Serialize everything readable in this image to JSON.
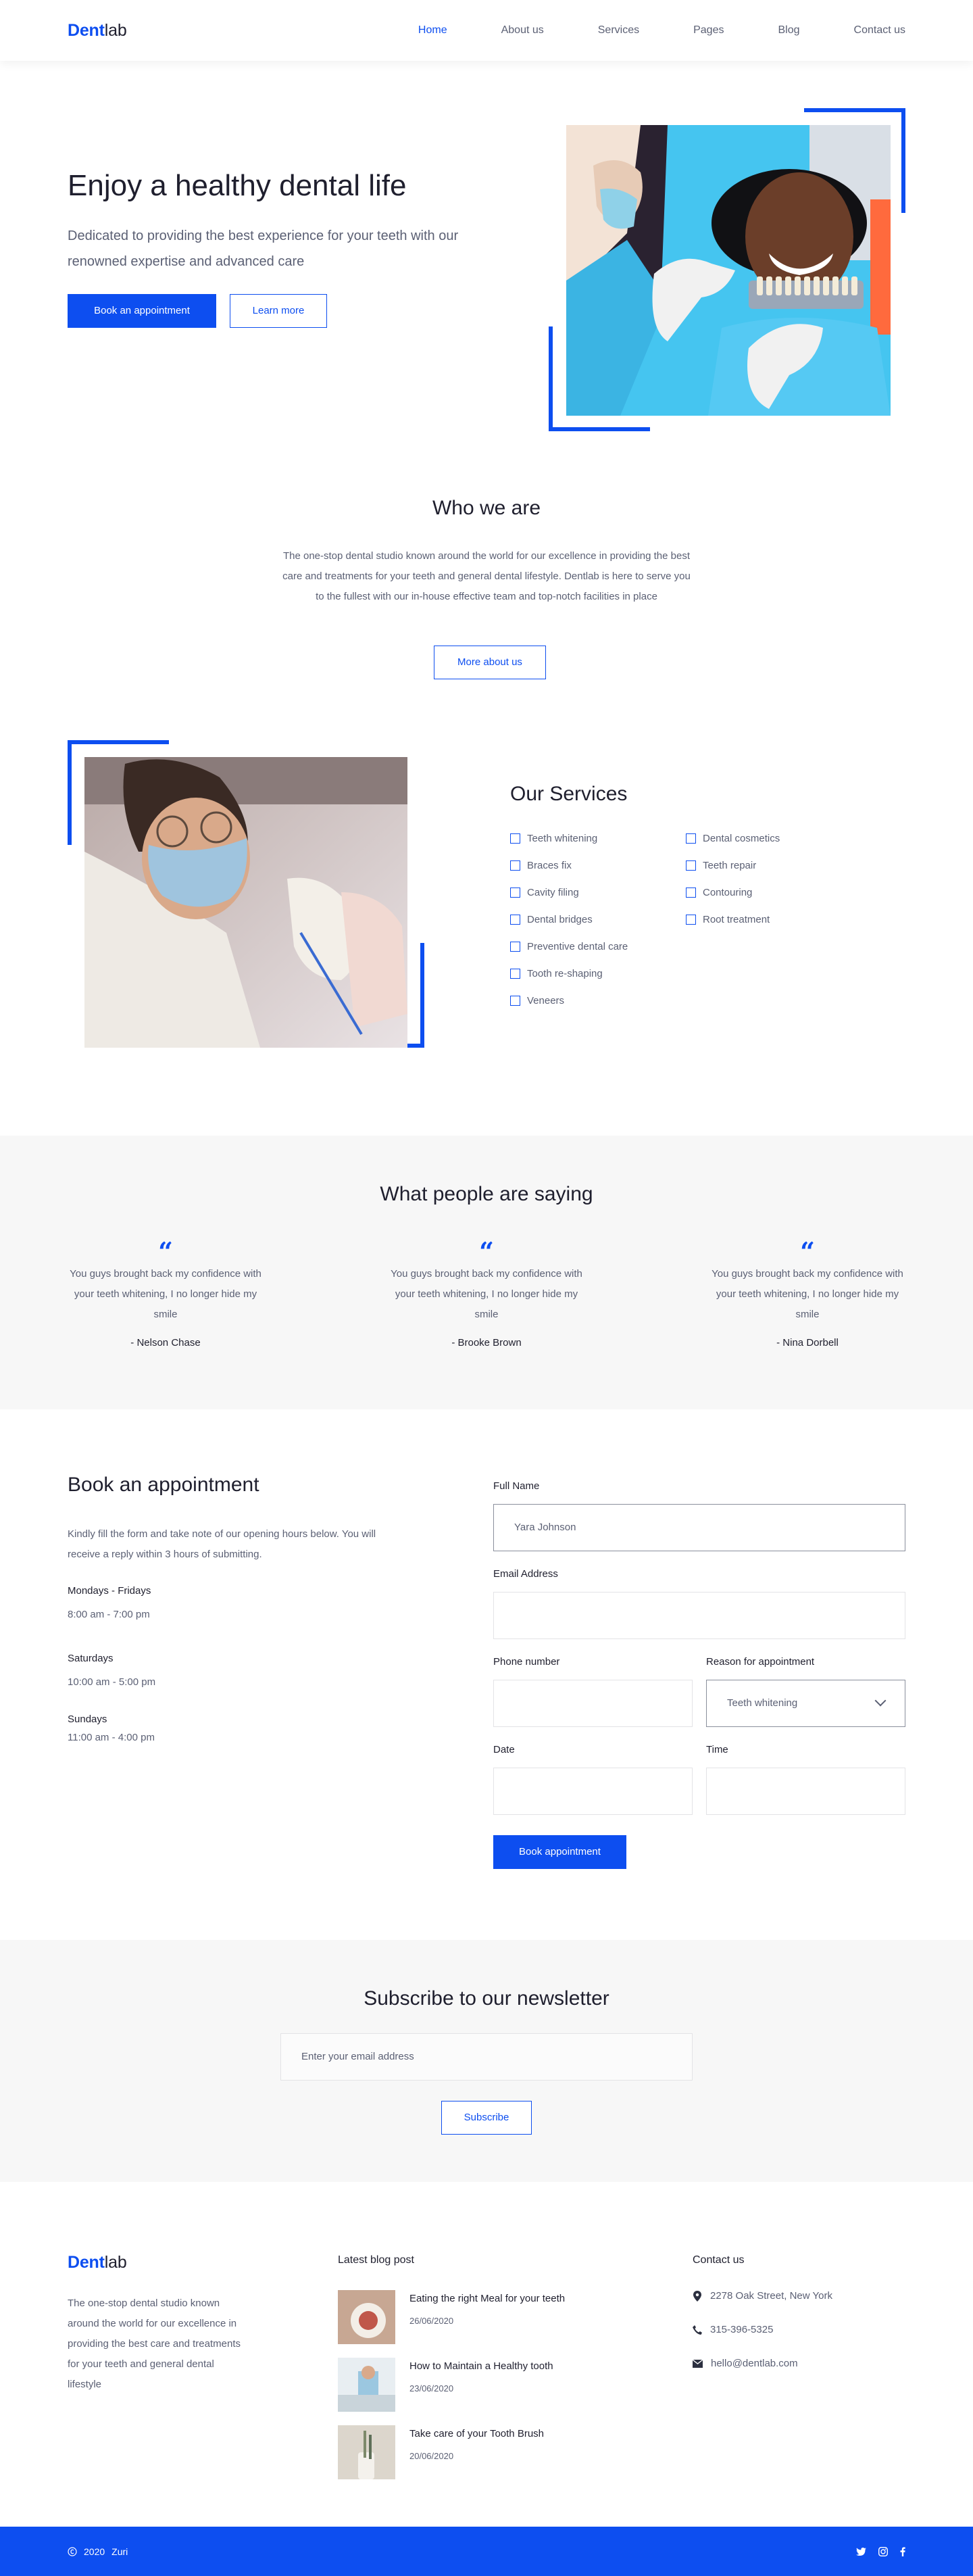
{
  "brand": {
    "part1": "Dent",
    "part2": "lab"
  },
  "nav": {
    "items": [
      {
        "label": "Home",
        "active": true
      },
      {
        "label": "About us",
        "active": false
      },
      {
        "label": "Services",
        "active": false
      },
      {
        "label": "Pages",
        "active": false
      },
      {
        "label": "Blog",
        "active": false
      },
      {
        "label": "Contact us",
        "active": false
      }
    ]
  },
  "hero": {
    "title": "Enjoy a healthy dental life",
    "subtitle": "Dedicated to providing the best experience for your teeth with our renowned expertise and advanced care",
    "primary_cta": "Book an appointment",
    "secondary_cta": "Learn more"
  },
  "about": {
    "title": "Who we are",
    "text": "The one-stop dental studio known around the world for our excellence in providing the best care and treatments for your teeth and general dental lifestyle. Dentlab is here to serve you to the fullest with our in-house effective team and top-notch facilities in place",
    "cta": "More about us"
  },
  "services": {
    "title": "Our Services",
    "col1": [
      "Teeth whitening",
      "Braces fix",
      "Cavity filing",
      "Dental bridges",
      "Preventive dental care",
      "Tooth re-shaping",
      "Veneers"
    ],
    "col2": [
      "Dental cosmetics",
      "Teeth repair",
      "Contouring",
      "Root treatment"
    ]
  },
  "testimonials": {
    "title": "What people are saying",
    "quote_mark": "“",
    "items": [
      {
        "text": "You guys brought back my confidence with your teeth whitening, I no longer hide my smile",
        "name": "- Nelson Chase"
      },
      {
        "text": "You guys brought back my confidence with your teeth whitening, I no longer hide my smile",
        "name": "- Brooke Brown"
      },
      {
        "text": "You guys brought back my confidence with your teeth whitening, I no longer hide my smile",
        "name": "- Nina Dorbell"
      }
    ]
  },
  "appointment": {
    "title": "Book an appointment",
    "desc": "Kindly fill the form and take note of our opening hours below. You will receive a reply within 3 hours of submitting.",
    "hours": [
      {
        "day": "Mondays - Fridays",
        "time": "8:00 am - 7:00 pm"
      },
      {
        "day": "Saturdays",
        "time": "10:00 am - 5:00 pm"
      },
      {
        "day": "Sundays",
        "time": "11:00 am - 4:00 pm"
      }
    ],
    "form": {
      "full_name_label": "Full Name",
      "full_name_value": "Yara Johnson",
      "email_label": "Email Address",
      "phone_label": "Phone number",
      "reason_label": "Reason for appointment",
      "reason_value": "Teeth whitening",
      "date_label": "Date",
      "time_label": "Time",
      "submit": "Book appointment"
    }
  },
  "newsletter": {
    "title": "Subscribe to our newsletter",
    "placeholder": "Enter your email address",
    "cta": "Subscribe"
  },
  "footer": {
    "desc": "The one-stop dental studio known around the world for our excellence in providing the best care and treatments for your teeth and general dental lifestyle",
    "blog_title": "Latest blog post",
    "posts": [
      {
        "title": "Eating the right Meal for your teeth",
        "date": "26/06/2020"
      },
      {
        "title": "How to Maintain a Healthy tooth",
        "date": "23/06/2020"
      },
      {
        "title": "Take care of your Tooth Brush",
        "date": "20/06/2020"
      }
    ],
    "contact_title": "Contact us",
    "address": "2278 Oak Street, New York",
    "phone": "315-396-5325",
    "email": "hello@dentlab.com"
  },
  "bottom_bar": {
    "year": "2020",
    "company": "Zuri",
    "social": [
      "twitter-icon",
      "instagram-icon",
      "facebook-icon"
    ]
  },
  "colors": {
    "accent": "#0d4ef0",
    "text_dark": "#1f1f2e",
    "text_muted": "#5b6074",
    "band_bg": "#f7f7f7"
  }
}
